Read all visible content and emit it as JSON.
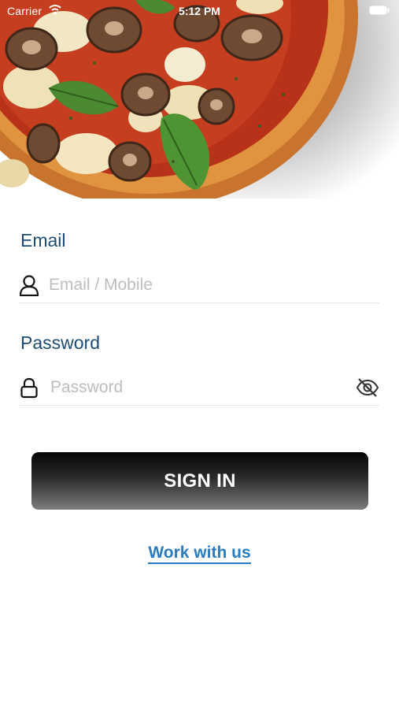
{
  "status_bar": {
    "carrier": "Carrier",
    "time": "5:12 PM"
  },
  "hero": {
    "image": "pizza-photo"
  },
  "login": {
    "email": {
      "label": "Email",
      "placeholder": "Email / Mobile",
      "value": "",
      "icon": "user-icon"
    },
    "password": {
      "label": "Password",
      "placeholder": "Password",
      "value": "",
      "icon": "lock-icon",
      "toggle_icon": "eye-off-icon"
    },
    "submit_label": "SIGN IN",
    "work_link": "Work with us"
  },
  "colors": {
    "label": "#1d4b73",
    "link": "#2a7bc0",
    "button_dark": "#050505",
    "button_light": "#7d7d7d",
    "background": "#ffffff"
  }
}
